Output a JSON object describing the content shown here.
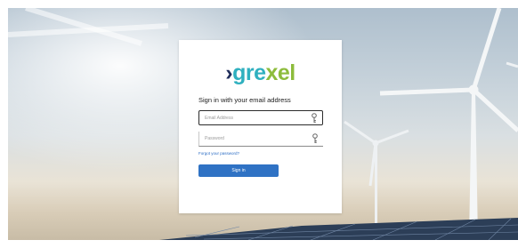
{
  "logo": {
    "chevron": "›",
    "part1": "gre",
    "part2": "xel"
  },
  "signin": {
    "heading": "Sign in with your email address",
    "email_placeholder": "Email Address",
    "password_placeholder": "Password",
    "forgot_link": "Forgot your password?",
    "button_label": "Sign in"
  },
  "icons": {
    "email_field_icon": "key-icon",
    "password_field_icon": "key-icon"
  },
  "colors": {
    "logo_chevron": "#1f2d5a",
    "logo_teal": "#2fb0bf",
    "logo_green": "#8dbc3c",
    "button_blue": "#2f72c4",
    "link_blue": "#2a6cc4"
  }
}
